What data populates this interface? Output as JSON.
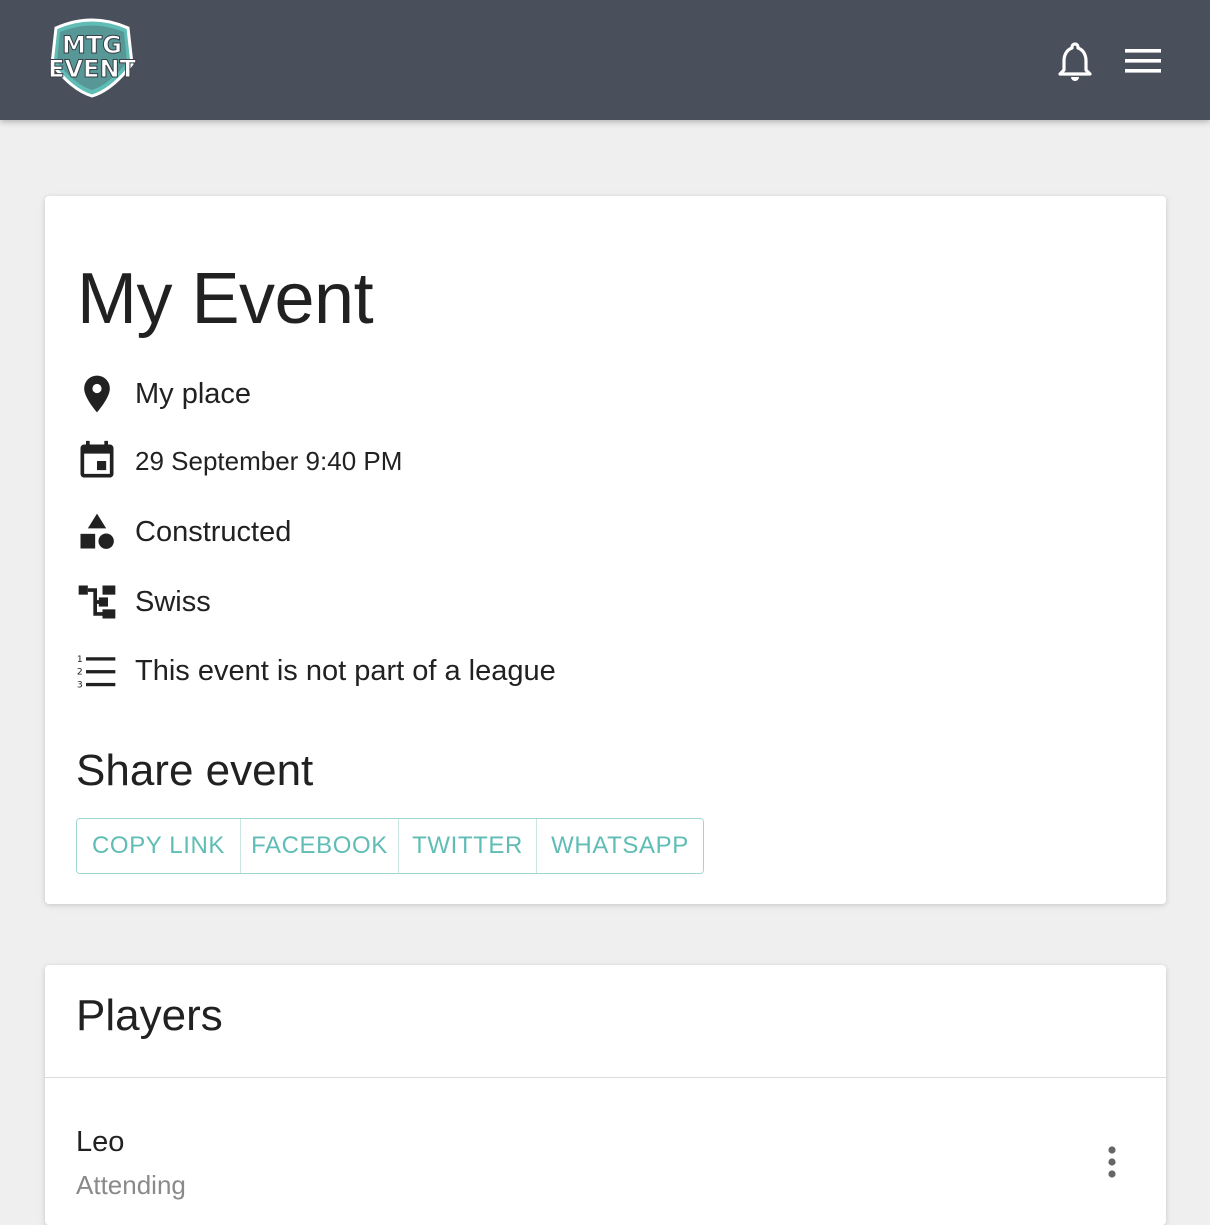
{
  "header": {
    "logo_line1": "MTG",
    "logo_line2": "EVENT",
    "notifications_icon": "bell-icon",
    "menu_icon": "hamburger-menu-icon"
  },
  "event": {
    "title": "My Event",
    "location": "My place",
    "location_icon": "map-pin-icon",
    "datetime": "29 September 9:40 PM",
    "datetime_icon": "calendar-icon",
    "format": "Constructed",
    "format_icon": "shapes-icon",
    "structure": "Swiss",
    "structure_icon": "bracket-icon",
    "league": "This event is not part of a league",
    "league_icon": "numbered-list-icon"
  },
  "share": {
    "title": "Share event",
    "buttons": [
      "COPY LINK",
      "FACEBOOK",
      "TWITTER",
      "WHATSAPP"
    ]
  },
  "players": {
    "title": "Players",
    "list": [
      {
        "name": "Leo",
        "status": "Attending"
      }
    ]
  },
  "colors": {
    "appbar": "#4a4f5c",
    "accent": "#5fbdb5",
    "background": "#efefef"
  }
}
